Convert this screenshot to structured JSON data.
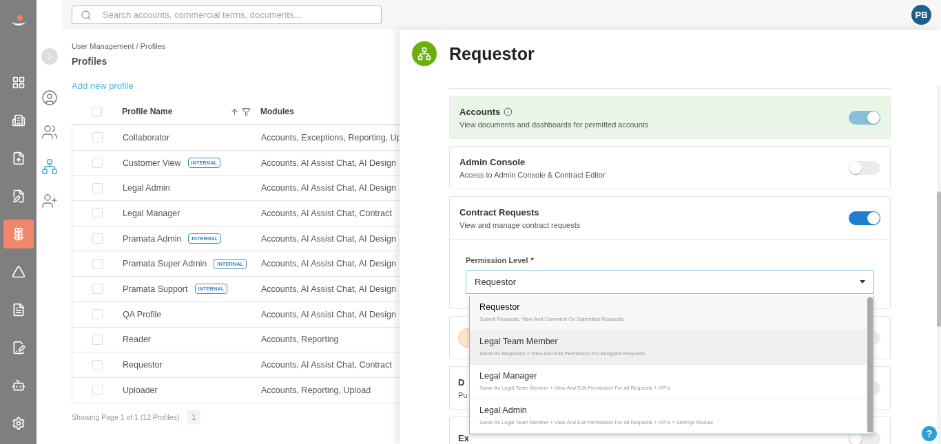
{
  "search": {
    "placeholder": "Search accounts, commercial terms, documents..."
  },
  "user": {
    "initials": "PB"
  },
  "main_nav": [
    {
      "kind": "grid",
      "selected": false
    },
    {
      "kind": "building",
      "selected": false
    },
    {
      "kind": "upload",
      "selected": false
    },
    {
      "kind": "edit",
      "selected": false
    },
    {
      "kind": "flower",
      "selected": true
    },
    {
      "kind": "triangle",
      "selected": false
    },
    {
      "kind": "doc",
      "selected": false
    },
    {
      "kind": "sign",
      "selected": false
    },
    {
      "kind": "bot",
      "selected": false
    },
    {
      "kind": "gear",
      "selected": false
    }
  ],
  "sub_nav": [
    {
      "kind": "user",
      "selected": false
    },
    {
      "kind": "group",
      "selected": false
    },
    {
      "kind": "hierarchy",
      "selected": true
    },
    {
      "kind": "add-user",
      "selected": false
    }
  ],
  "breadcrumb": "User Management / Profiles",
  "page_title": "Profiles",
  "add_link": "Add new profile",
  "table": {
    "all_checked": false,
    "columns": [
      "Profile Name",
      "Modules"
    ],
    "rows": [
      {
        "name": "Collaborator",
        "modules": "Accounts, Exceptions, Reporting, Up",
        "checked": false
      },
      {
        "name": "Customer View",
        "tag": "INTERNAL",
        "modules": "Accounts, AI Assist Chat, AI Design",
        "checked": false
      },
      {
        "name": "Legal Admin",
        "modules": "Accounts, AI Assist Chat, AI Design",
        "checked": false
      },
      {
        "name": "Legal Manager",
        "modules": "Accounts, AI Assist Chat, Contract",
        "checked": false
      },
      {
        "name": "Pramata Admin",
        "tag": "INTERNAL",
        "modules": "Accounts, AI Assist Chat, AI Design",
        "checked": false
      },
      {
        "name": "Pramata Super Admin",
        "tag": "INTERNAL",
        "modules": "Accounts, AI Assist Chat, AI Design",
        "checked": false
      },
      {
        "name": "Pramata Support",
        "tag": "INTERNAL",
        "modules": "Accounts, AI Assist Chat, AI Design",
        "checked": false
      },
      {
        "name": "QA Profile",
        "modules": "Accounts, AI Assist Chat, AI Design",
        "checked": false
      },
      {
        "name": "Reader",
        "modules": "Accounts, Reporting",
        "checked": false
      },
      {
        "name": "Requestor",
        "modules": "Accounts, AI Assist Chat, Contract",
        "checked": false
      },
      {
        "name": "Uploader",
        "modules": "Accounts, Reporting, Upload",
        "checked": false
      }
    ]
  },
  "footer": {
    "text": "Showing Page 1 of 1 (12 Profiles)",
    "pages": [
      {
        "label": "1",
        "selected": true
      }
    ]
  },
  "panel": {
    "title": "Requestor",
    "modules": [
      {
        "title": "Accounts",
        "info": true,
        "description": "View documents and dashboards for permitted accounts",
        "on": true,
        "disabled": true,
        "highlighted": true,
        "expanded": false
      },
      {
        "title": "Admin Console",
        "info": false,
        "description": "Access to Admin Console & Contract Editor",
        "on": false,
        "disabled": false,
        "highlighted": false,
        "expanded": false
      },
      {
        "title": "Contract Requests",
        "info": false,
        "description": "View and manage contract requests",
        "on": true,
        "disabled": false,
        "highlighted": false,
        "expanded": true
      }
    ],
    "permission": {
      "label": "Permission Level",
      "required_mark": "*",
      "value": "Requestor",
      "options": [
        {
          "name": "Requestor",
          "description": "Submit Requests, View And Comment On Submitted Requests.",
          "selected": true,
          "hovered": false
        },
        {
          "name": "Legal Team Member",
          "description": "Same As Requestor + View And Edit Permission For Assigned Requests.",
          "selected": false,
          "hovered": true
        },
        {
          "name": "Legal Manager",
          "description": "Same As Legal Team Member + View And Edit Permission For All Requests + KPI's",
          "selected": false,
          "hovered": false
        },
        {
          "name": "Legal Admin",
          "description": "Same As Legal Team Member + View And Edit Permission For All Requests + KPI's + Settings Module",
          "selected": false,
          "hovered": false
        }
      ]
    },
    "more_modules": [
      {
        "kind": "icon",
        "on": false
      },
      {
        "kind": "text",
        "title": "D",
        "description": "Pu",
        "on": false
      },
      {
        "kind": "text",
        "title": "Ex",
        "on": false
      }
    ]
  },
  "help": {
    "label": "?"
  }
}
